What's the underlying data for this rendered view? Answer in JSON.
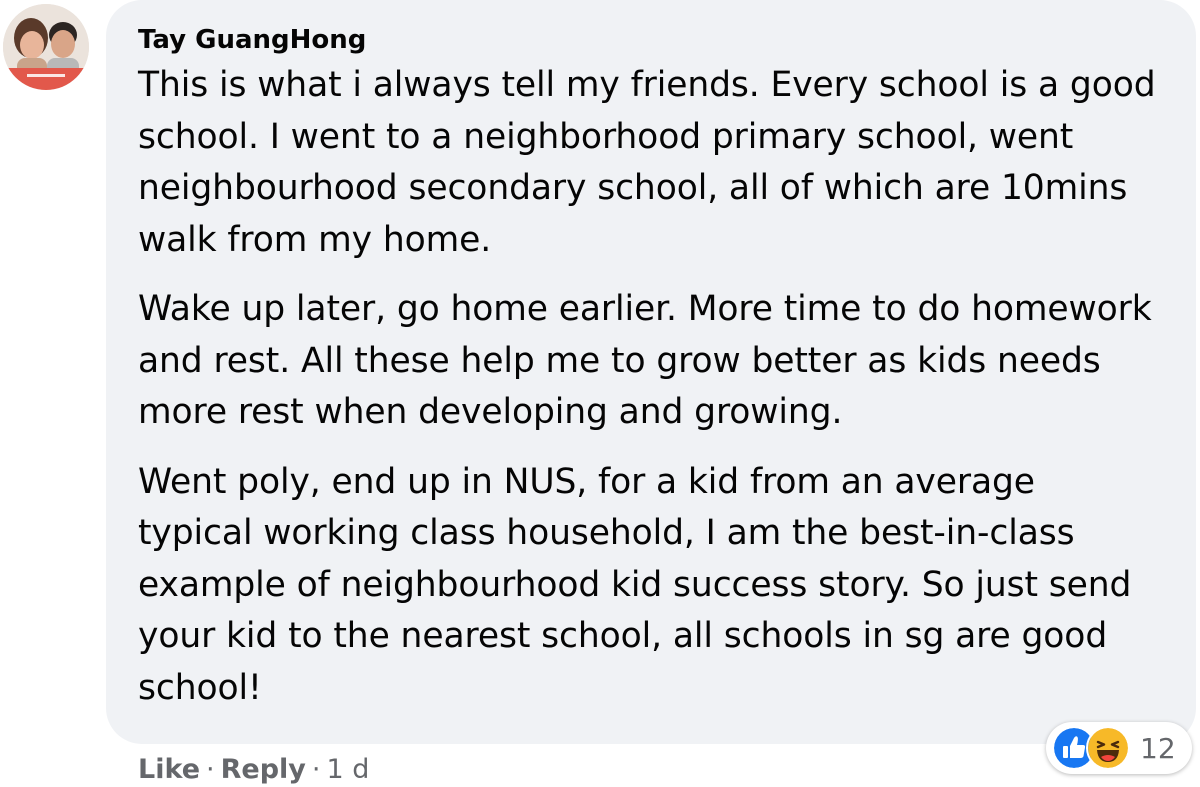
{
  "comment": {
    "author": "Tay GuangHong",
    "paragraphs": [
      "This is what i always tell my friends. Every school is a good school. I went to a neighborhood primary school, went neighbourhood secondary school, all of which are 10mins walk from my home.",
      "Wake up later, go home earlier. More time to do homework and rest. All these help me to grow better as kids needs more rest when developing and growing.",
      "Went poly, end up in NUS, for a kid from an average typical working class household, I am the best-in-class example of neighbourhood kid success story. So just send your kid to the nearest school, all schools in sg are good school!"
    ],
    "reactions": {
      "icons": [
        "like-icon",
        "haha-icon"
      ],
      "count": "12"
    },
    "actions": {
      "like": "Like",
      "separator": "·",
      "reply": "Reply",
      "timestamp": "1 d"
    },
    "colors": {
      "bubble": "#f0f2f5",
      "text": "#050505",
      "meta": "#65676b",
      "like_blue": "#1877f2",
      "haha_yellow": "#f7b928"
    }
  }
}
